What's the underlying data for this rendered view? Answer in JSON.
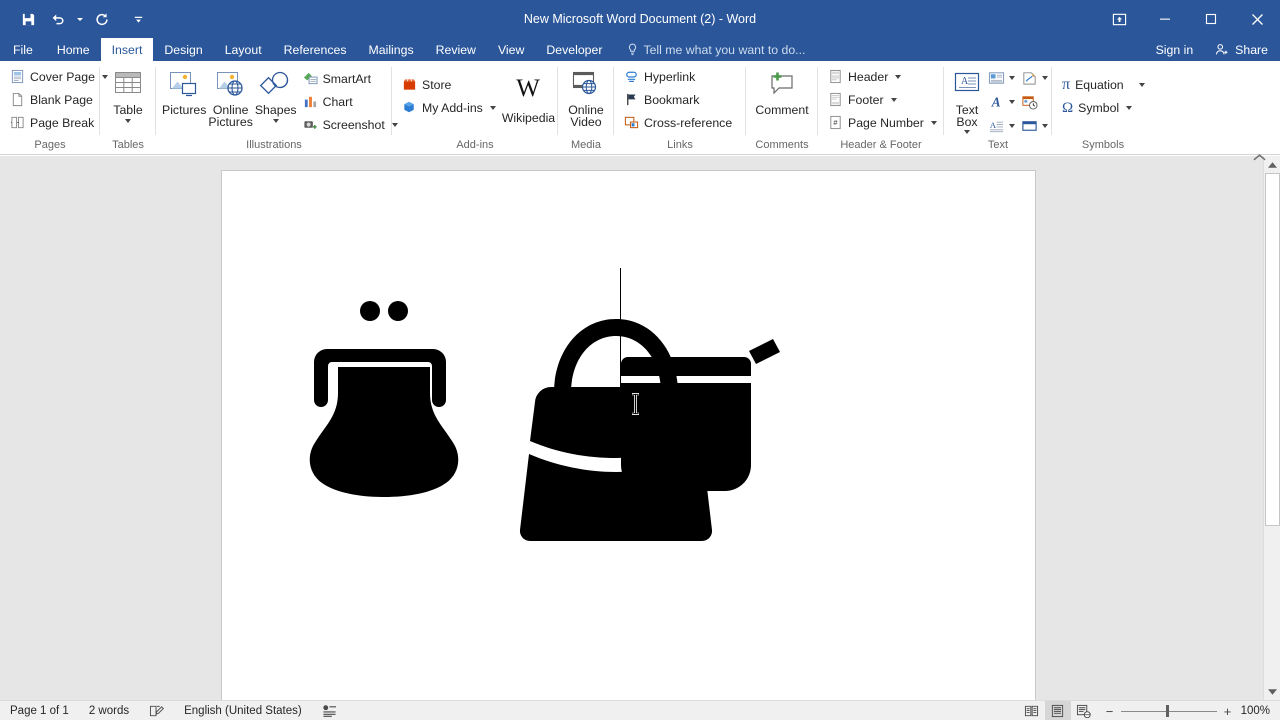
{
  "window": {
    "title": "New Microsoft Word Document (2) - Word",
    "quick_access": [
      {
        "name": "save",
        "icon": "save-icon"
      },
      {
        "name": "undo",
        "icon": "undo-icon"
      },
      {
        "name": "redo",
        "icon": "redo-icon"
      },
      {
        "name": "customize",
        "icon": "customize-qat-icon"
      }
    ],
    "ribbon_display_options": "ribbon-display-options-icon",
    "minimize": "minimize-icon",
    "maximize": "maximize-icon",
    "close": "close-icon"
  },
  "tabs": [
    {
      "label": "File",
      "active": false
    },
    {
      "label": "Home",
      "active": false
    },
    {
      "label": "Insert",
      "active": true
    },
    {
      "label": "Design",
      "active": false
    },
    {
      "label": "Layout",
      "active": false
    },
    {
      "label": "References",
      "active": false
    },
    {
      "label": "Mailings",
      "active": false
    },
    {
      "label": "Review",
      "active": false
    },
    {
      "label": "View",
      "active": false
    },
    {
      "label": "Developer",
      "active": false
    }
  ],
  "tellme": {
    "placeholder": "Tell me what you want to do..."
  },
  "account": {
    "signin": "Sign in",
    "share": "Share"
  },
  "ribbon": {
    "groups": [
      {
        "name": "pages",
        "label": "Pages",
        "items": [
          {
            "label": "Cover Page",
            "dropdown": true
          },
          {
            "label": "Blank Page",
            "dropdown": false
          },
          {
            "label": "Page Break",
            "dropdown": false
          }
        ]
      },
      {
        "name": "tables",
        "label": "Tables",
        "items": [
          {
            "label": "Table",
            "dropdown": true
          }
        ]
      },
      {
        "name": "illustrations",
        "label": "Illustrations",
        "items": [
          {
            "label": "Pictures",
            "dropdown": false
          },
          {
            "label": "Online Pictures",
            "dropdown": false
          },
          {
            "label": "Shapes",
            "dropdown": true
          },
          {
            "label": "SmartArt",
            "dropdown": false
          },
          {
            "label": "Chart",
            "dropdown": false
          },
          {
            "label": "Screenshot",
            "dropdown": true
          }
        ]
      },
      {
        "name": "addins",
        "label": "Add-ins",
        "items": [
          {
            "label": "Store",
            "dropdown": false
          },
          {
            "label": "My Add-ins",
            "dropdown": true
          },
          {
            "label": "Wikipedia",
            "dropdown": false
          }
        ]
      },
      {
        "name": "media",
        "label": "Media",
        "items": [
          {
            "label": "Online Video",
            "dropdown": false
          }
        ]
      },
      {
        "name": "links",
        "label": "Links",
        "items": [
          {
            "label": "Hyperlink",
            "dropdown": false
          },
          {
            "label": "Bookmark",
            "dropdown": false
          },
          {
            "label": "Cross-reference",
            "dropdown": false
          }
        ]
      },
      {
        "name": "comments",
        "label": "Comments",
        "items": [
          {
            "label": "Comment",
            "dropdown": false
          }
        ]
      },
      {
        "name": "header-footer",
        "label": "Header & Footer",
        "items": [
          {
            "label": "Header",
            "dropdown": true
          },
          {
            "label": "Footer",
            "dropdown": true
          },
          {
            "label": "Page Number",
            "dropdown": true
          }
        ]
      },
      {
        "name": "text",
        "label": "Text",
        "items": [
          {
            "label": "Text Box",
            "dropdown": true
          },
          {
            "label": "Quick Parts",
            "dropdown": true
          },
          {
            "label": "WordArt",
            "dropdown": true
          },
          {
            "label": "Drop Cap",
            "dropdown": true
          },
          {
            "label": "Signature Line",
            "dropdown": true
          },
          {
            "label": "Date & Time",
            "dropdown": false
          },
          {
            "label": "Object",
            "dropdown": true
          }
        ]
      },
      {
        "name": "symbols",
        "label": "Symbols",
        "items": [
          {
            "label": "Equation",
            "dropdown": true
          },
          {
            "label": "Symbol",
            "dropdown": true
          }
        ]
      }
    ],
    "collapse_icon": "chevron-up-icon"
  },
  "document": {
    "shapes": [
      {
        "name": "coin-purse-icon",
        "alt": "Coin purse with clasp"
      },
      {
        "name": "handbag-icon",
        "alt": "Handbag with handle"
      },
      {
        "name": "zipper-pouch-icon",
        "alt": "Zippered pouch wallet"
      }
    ],
    "caret_visible": true,
    "cursor": "i-beam-cursor"
  },
  "statusbar": {
    "page": "Page 1 of 1",
    "words": "2 words",
    "proofing_icon": "proofing-errors-icon",
    "language": "English (United States)",
    "macro_icon": "macro-record-icon",
    "views": [
      {
        "name": "read-mode",
        "active": false
      },
      {
        "name": "print-layout",
        "active": true
      },
      {
        "name": "web-layout",
        "active": false
      }
    ],
    "focus_icon": "focus-mode-icon",
    "zoom_out": "−",
    "zoom_in": "+",
    "zoom_level": "100%"
  }
}
